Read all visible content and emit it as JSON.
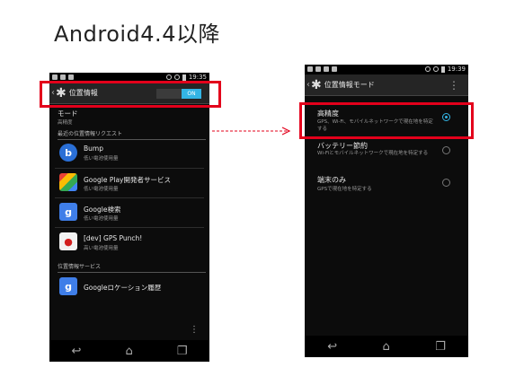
{
  "slide": {
    "title": "Android4.4以降"
  },
  "left_phone": {
    "status_time": "19:35",
    "header_title": "位置情報",
    "toggle_label": "ON",
    "mode_label": "モード",
    "mode_value": "高精度",
    "recent_header": "最近の位置情報リクエスト",
    "apps": [
      {
        "name": "Bump",
        "sub": "低い電池使用量",
        "icon": "bump-icon"
      },
      {
        "name": "Google Play開発者サービス",
        "sub": "低い電池使用量",
        "icon": "puzzle-icon"
      },
      {
        "name": "Google検索",
        "sub": "低い電池使用量",
        "icon": "google-g-icon"
      },
      {
        "name": "[dev] GPS Punch!",
        "sub": "高い電池使用量",
        "icon": "map-pin-icon"
      }
    ],
    "services_header": "位置情報サービス",
    "service_item": "Googleロケーション履歴"
  },
  "right_phone": {
    "status_time": "19:39",
    "header_title": "位置情報モード",
    "options": [
      {
        "title": "高精度",
        "desc": "GPS、Wi-Fi、モバイルネットワークで現在地を特定する",
        "selected": true
      },
      {
        "title": "バッテリー節約",
        "desc": "Wi-Fiとモバイルネットワークで現在地を特定する",
        "selected": false
      },
      {
        "title": "端末のみ",
        "desc": "GPSで現在地を特定する",
        "selected": false
      }
    ]
  },
  "colors": {
    "highlight": "#e3001b",
    "accent": "#33b5e5"
  }
}
